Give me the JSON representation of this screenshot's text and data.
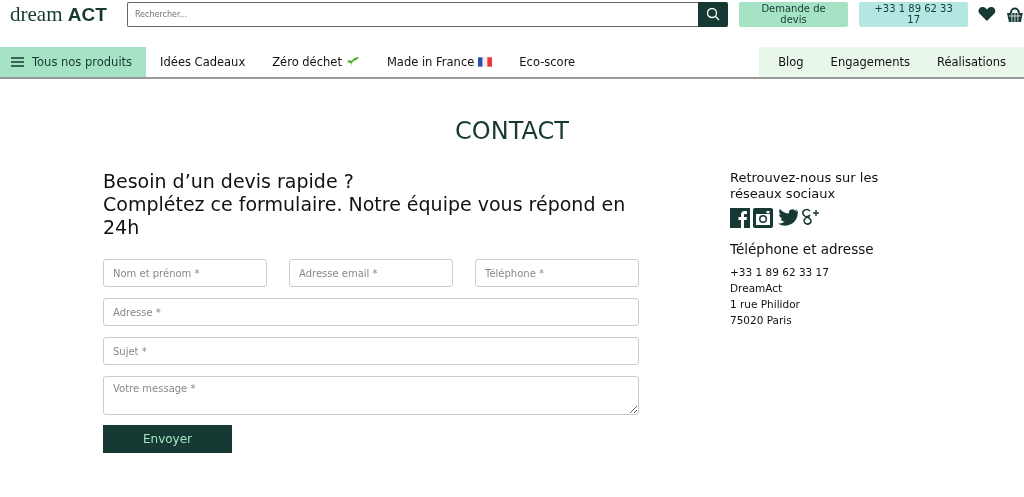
{
  "header": {
    "logo": {
      "light": "dream",
      "bold": "ACT"
    },
    "search": {
      "placeholder": "Rechercher..."
    },
    "quote_button": "Demande de devis",
    "phone_button": "+33 1 89 62 33 17"
  },
  "nav": {
    "all_products": {
      "label": "Tous nos produits",
      "selected": true
    },
    "items": [
      {
        "label": "Idées Cadeaux",
        "kind": "plain"
      },
      {
        "label": "Zéro déchet",
        "kind": "sprout"
      },
      {
        "label": "Made in France",
        "kind": "flag"
      },
      {
        "label": "Eco-score",
        "kind": "plain"
      }
    ],
    "right_items": [
      "Blog",
      "Engagements",
      "Réalisations"
    ]
  },
  "page_title": "CONTACT",
  "form": {
    "heading_lines": [
      "Besoin d’un devis rapide ?",
      "Complétez ce formulaire. Notre équipe vous répond en 24h"
    ],
    "row_fields": [
      {
        "placeholder": "Nom et prénom *"
      },
      {
        "placeholder": "Adresse email *"
      },
      {
        "placeholder": "Téléphone *"
      }
    ],
    "fields": [
      {
        "placeholder": "Adresse *",
        "kind": "input"
      },
      {
        "placeholder": "Sujet *",
        "kind": "input"
      },
      {
        "placeholder": "Votre message *",
        "kind": "textarea"
      }
    ],
    "submit": "Envoyer"
  },
  "sidebar": {
    "social_heading": "Retrouvez-nous sur les réseaux sociaux",
    "contact_heading": "Téléphone et adresse",
    "contact_lines": [
      "+33 1 89 62 33 17",
      "DreamAct",
      "1 rue Philidor",
      "75020 Paris"
    ]
  }
}
